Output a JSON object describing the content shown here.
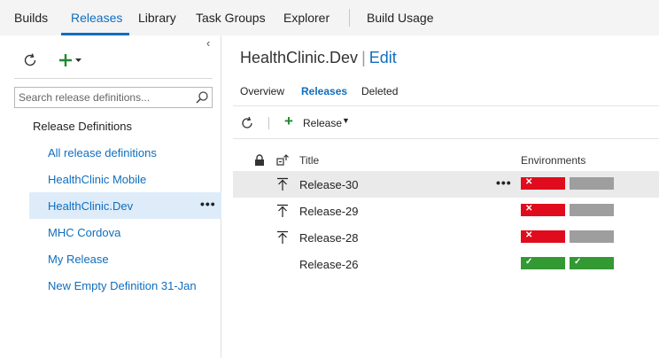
{
  "topnav": {
    "tabs": [
      {
        "label": "Builds"
      },
      {
        "label": "Releases"
      },
      {
        "label": "Library"
      },
      {
        "label": "Task Groups"
      },
      {
        "label": "Explorer"
      },
      {
        "label": "Build Usage"
      }
    ],
    "active_tab": "Releases"
  },
  "sidebar": {
    "search": {
      "placeholder": "Search release definitions...",
      "value": ""
    },
    "root_label": "Release Definitions",
    "items": [
      {
        "label": "All release definitions"
      },
      {
        "label": "HealthClinic Mobile"
      },
      {
        "label": "HealthClinic.Dev",
        "more": "•••"
      },
      {
        "label": "MHC Cordova"
      },
      {
        "label": "My Release"
      },
      {
        "label": "New Empty Definition 31-Jan"
      }
    ],
    "selected": "HealthClinic.Dev"
  },
  "main": {
    "title": "HealthClinic.Dev",
    "separator": "|",
    "edit_label": "Edit",
    "subtabs": [
      {
        "label": "Overview"
      },
      {
        "label": "Releases"
      },
      {
        "label": "Deleted"
      }
    ],
    "active_subtab": "Releases",
    "toolbar": {
      "release_label": "Release"
    },
    "table": {
      "headers": {
        "title": "Title",
        "environments": "Environments"
      },
      "rows": [
        {
          "name": "Release-30",
          "more": "•••",
          "environments": [
            "failed",
            "not-deployed"
          ]
        },
        {
          "name": "Release-29",
          "environments": [
            "failed",
            "not-deployed"
          ]
        },
        {
          "name": "Release-28",
          "environments": [
            "failed",
            "not-deployed"
          ]
        },
        {
          "name": "Release-26",
          "environments": [
            "succeeded",
            "succeeded"
          ]
        }
      ]
    }
  },
  "colors": {
    "accent": "#106ebe",
    "failed": "#e00b1c",
    "succeeded": "#339933",
    "not_deployed": "#9e9e9e",
    "add_green": "#1d8a2f"
  },
  "icons": {
    "refresh": "refresh-icon",
    "add": "plus-icon",
    "search": "search-icon",
    "lock": "lock-icon",
    "deploy": "deploy-icon",
    "upload_arrow": "arrow-up-to-line-icon",
    "collapse": "chevron-left-icon"
  }
}
